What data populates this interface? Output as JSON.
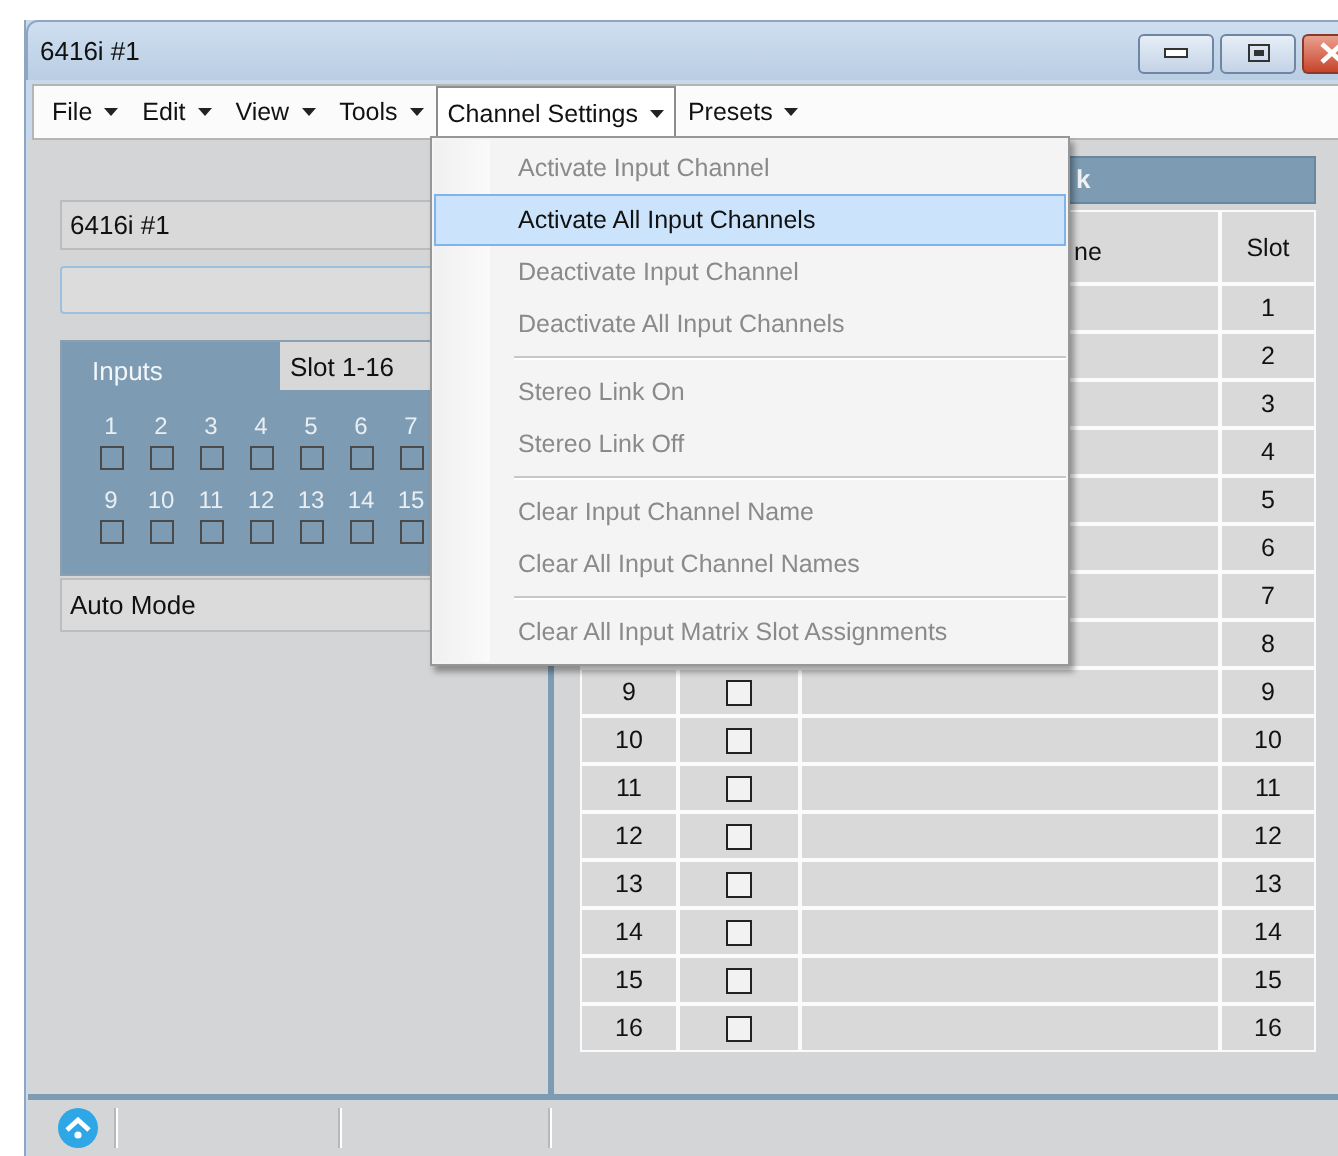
{
  "window": {
    "title": "6416i #1"
  },
  "menu_bar": [
    {
      "label": "File",
      "selected": false
    },
    {
      "label": "Edit",
      "selected": false
    },
    {
      "label": "View",
      "selected": false
    },
    {
      "label": "Tools",
      "selected": false
    },
    {
      "label": "Channel Settings",
      "selected": true
    },
    {
      "label": "Presets",
      "selected": false
    }
  ],
  "dropdown": {
    "groups": [
      [
        {
          "label": "Activate Input Channel",
          "disabled": true,
          "selected": false
        },
        {
          "label": "Activate All Input Channels",
          "disabled": false,
          "selected": true
        },
        {
          "label": "Deactivate Input Channel",
          "disabled": true,
          "selected": false
        },
        {
          "label": "Deactivate All Input Channels",
          "disabled": true,
          "selected": false
        }
      ],
      [
        {
          "label": "Stereo Link On",
          "disabled": true,
          "selected": false
        },
        {
          "label": "Stereo Link Off",
          "disabled": true,
          "selected": false
        }
      ],
      [
        {
          "label": "Clear Input Channel Name",
          "disabled": true,
          "selected": false
        },
        {
          "label": "Clear All Input Channel Names",
          "disabled": true,
          "selected": false
        }
      ],
      [
        {
          "label": "Clear All Input Matrix Slot Assignments",
          "disabled": true,
          "selected": false
        }
      ]
    ]
  },
  "left_panel": {
    "device_name": "6416i #1",
    "inputs_group": {
      "title": "Inputs",
      "slot_tab": "Slot 1-16",
      "channel_rows": [
        [
          {
            "number": "1",
            "checked": false
          },
          {
            "number": "2",
            "checked": false
          },
          {
            "number": "3",
            "checked": false
          },
          {
            "number": "4",
            "checked": false
          },
          {
            "number": "5",
            "checked": false
          },
          {
            "number": "6",
            "checked": false
          },
          {
            "number": "7",
            "checked": false
          }
        ],
        [
          {
            "number": "9",
            "checked": false
          },
          {
            "number": "10",
            "checked": false
          },
          {
            "number": "11",
            "checked": false
          },
          {
            "number": "12",
            "checked": false
          },
          {
            "number": "13",
            "checked": false
          },
          {
            "number": "14",
            "checked": false
          },
          {
            "number": "15",
            "checked": false
          }
        ]
      ]
    },
    "mode": "Auto Mode"
  },
  "right_panel": {
    "header": "k",
    "table": {
      "columns": [
        {
          "label": "ne"
        },
        {
          "label": "Slot"
        }
      ],
      "rows": [
        {
          "slot": "1"
        },
        {
          "slot": "2"
        },
        {
          "slot": "3"
        },
        {
          "slot": "4"
        },
        {
          "slot": "5"
        },
        {
          "slot": "6"
        },
        {
          "slot": "7"
        },
        {
          "slot": "8"
        },
        {
          "number": "9",
          "checked": false,
          "slot": "9"
        },
        {
          "number": "10",
          "checked": false,
          "slot": "10"
        },
        {
          "number": "11",
          "checked": false,
          "slot": "11"
        },
        {
          "number": "12",
          "checked": false,
          "slot": "12"
        },
        {
          "number": "13",
          "checked": false,
          "slot": "13"
        },
        {
          "number": "14",
          "checked": false,
          "slot": "14"
        },
        {
          "number": "15",
          "checked": false,
          "slot": "15"
        },
        {
          "number": "16",
          "checked": false,
          "slot": "16"
        }
      ]
    }
  }
}
